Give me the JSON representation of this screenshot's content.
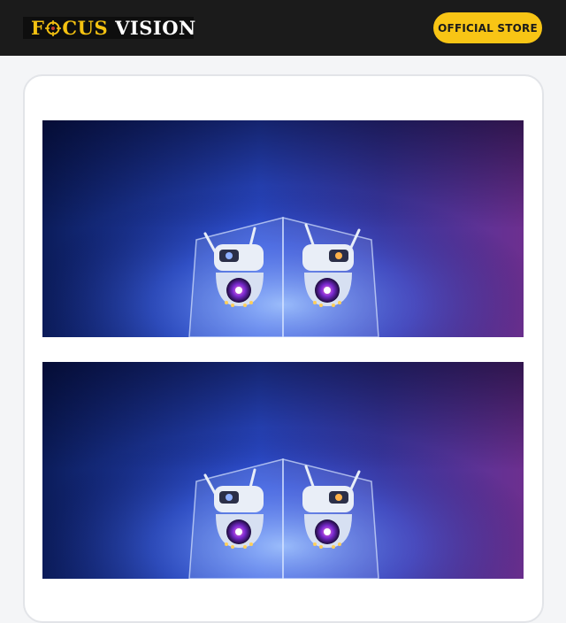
{
  "header": {
    "logo": {
      "word1_before": "F",
      "word1_after": "CUS",
      "word2": "VISION"
    },
    "store_button_label": "OFFICIAL STORE"
  },
  "colors": {
    "header_bg": "#1b1b1b",
    "brand_yellow": "#f5c211",
    "button_bg": "#f8c515",
    "page_bg": "#f4f5f7",
    "card_bg": "#ffffff"
  },
  "content": {
    "banners": [
      {
        "name": "dual-camera-banner-1"
      },
      {
        "name": "dual-camera-banner-2"
      }
    ]
  }
}
